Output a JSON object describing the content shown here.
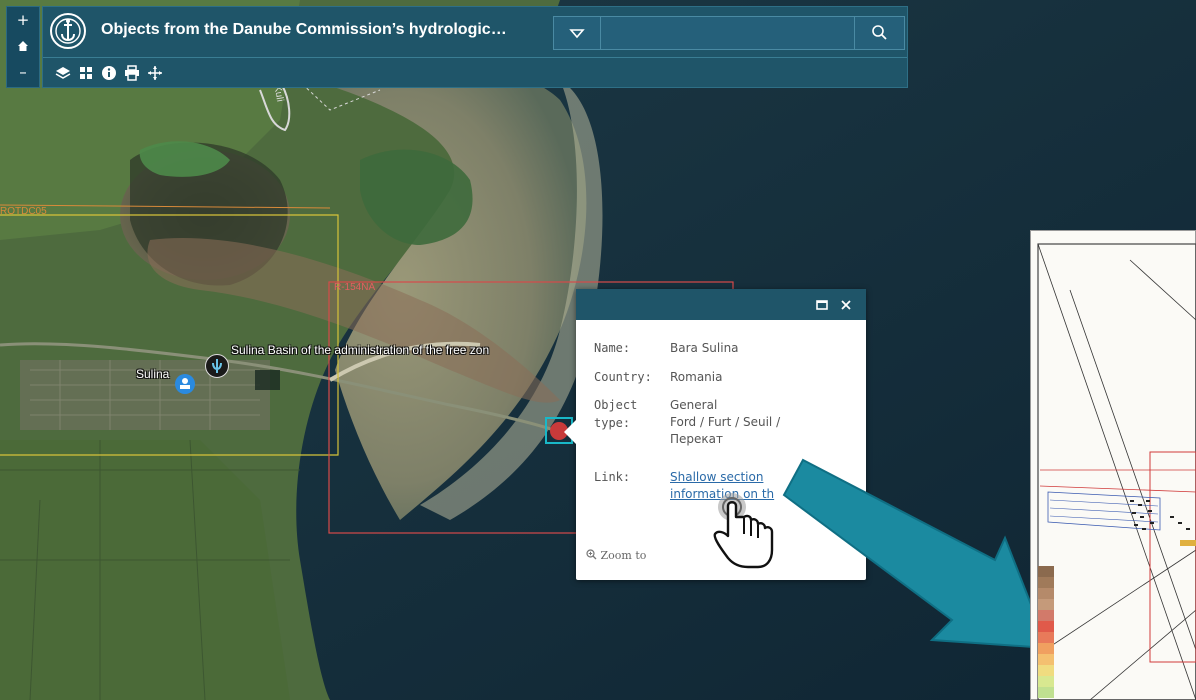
{
  "app": {
    "title": "Objects from the Danube Commission’s hydrologic…",
    "search_placeholder": "",
    "colors": {
      "header_bg": "#1f5569",
      "popup_header": "#1f5569",
      "link": "#2a6aa8",
      "arrow": "#1b8aa0",
      "ocean": "#112a3b"
    }
  },
  "map_controls": {
    "zoom_in": "+",
    "home_icon": "home-icon",
    "zoom_out": "–"
  },
  "toolbar": {
    "tools": [
      "layers-icon",
      "basemap-gallery-icon",
      "info-icon",
      "print-icon",
      "pan-icon"
    ]
  },
  "map": {
    "labels": {
      "sulina": "Sulina",
      "basin": "Sulina Basin of the administration of the free zon",
      "road": "Kuli",
      "frame1": "ROTDC05",
      "frame2": "R-154NA"
    }
  },
  "popup": {
    "fields": [
      {
        "label": "Name:",
        "value": "Bara Sulina"
      },
      {
        "label": "Country:",
        "value": "Romania"
      },
      {
        "label": "Object type:",
        "value_lines": [
          "General",
          "Ford / Furt / Seuil /",
          "Перекат"
        ]
      },
      {
        "label": "Link:",
        "link_text": "Shallow section information on th"
      }
    ],
    "label_object": "Object",
    "label_type": "type:",
    "link_line1": "Shallow section",
    "link_line2": "information on th",
    "zoom_to": "Zoom to",
    "maximize_icon": "maximize-icon",
    "close_icon": "close-icon"
  },
  "drawing_panel": {
    "legend_colors": [
      "#8b6a4e",
      "#a07a5a",
      "#b58a6a",
      "#c59a7a",
      "#d27a6a",
      "#e05a4a",
      "#e87a5a",
      "#f0a060",
      "#f4c070",
      "#f0dc80",
      "#d8e890",
      "#c0e090"
    ]
  }
}
